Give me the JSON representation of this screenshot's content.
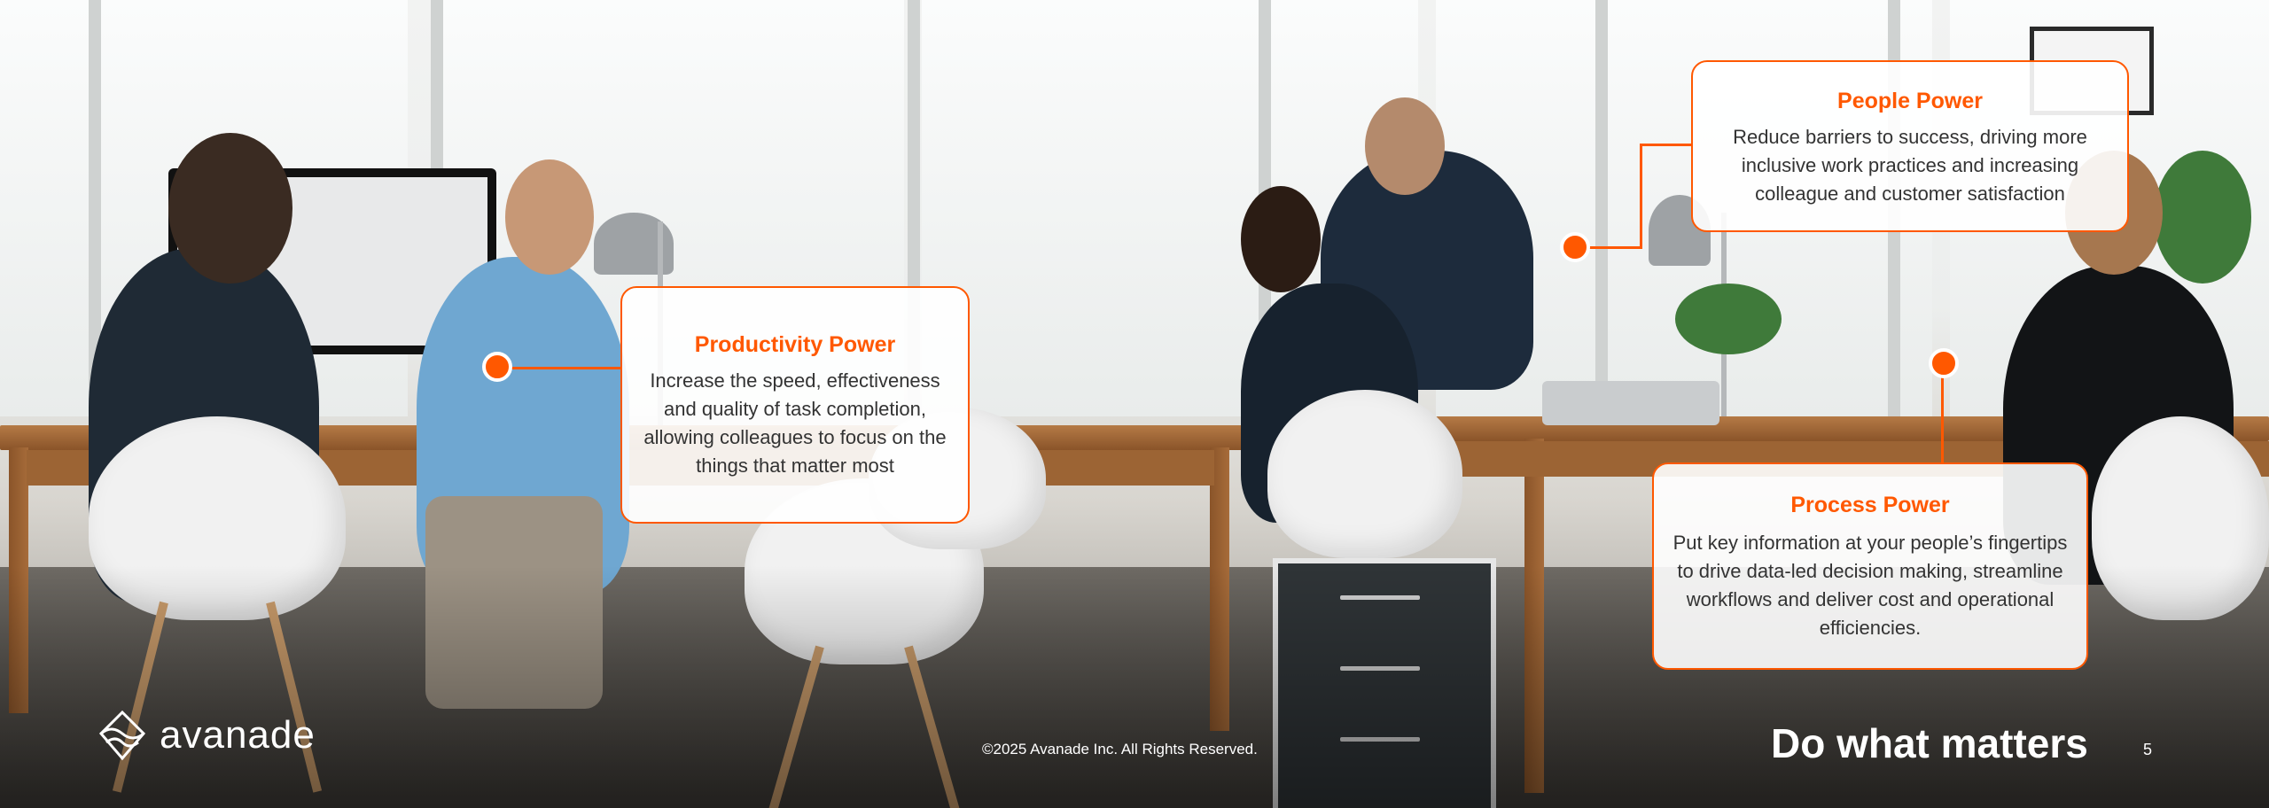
{
  "callouts": {
    "productivity": {
      "title": "Productivity Power",
      "body": "Increase the speed, effectiveness and quality of task completion, allowing colleagues to focus on the things that matter most"
    },
    "people": {
      "title": "People Power",
      "body": "Reduce barriers to success, driving more inclusive work practices and increasing colleague and customer satisfaction"
    },
    "process": {
      "title": "Process Power",
      "body": "Put key information at your people’s fingertips to drive data-led decision making, streamline workflows and deliver cost and operational efficiencies."
    }
  },
  "footer": {
    "logo_text": "avanade",
    "copyright": "©2025 Avanade Inc. All Rights Reserved.",
    "tagline": "Do what matters",
    "page_number": "5"
  },
  "colors": {
    "accent": "#ff5800",
    "card_background": "#ffffff",
    "footer_text": "#ffffff"
  },
  "icons": [
    "avanade-logo-icon"
  ]
}
